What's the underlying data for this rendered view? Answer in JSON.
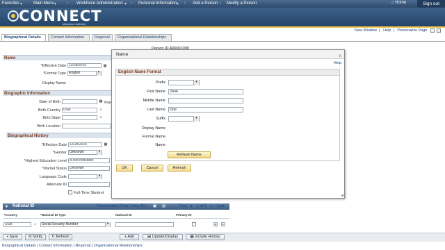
{
  "nav": {
    "items": [
      "Favorites",
      "Main Menu",
      "Workforce Administration",
      "Personal Information",
      "Add a Person",
      "Modify a Person"
    ],
    "home": "Home",
    "signout": "Sign out"
  },
  "banner": {
    "title": "CONNECT",
    "subtitle": "Maryland Judiciary"
  },
  "toplinks": {
    "new_window": "New Window",
    "help": "Help",
    "personalize": "Personalize Page"
  },
  "tabs": [
    "Biographical Details",
    "Contact Information",
    "Regional",
    "Organizational Relationships"
  ],
  "person": {
    "id_label": "Person ID",
    "id_value": "A00001000"
  },
  "name_section": {
    "header": "Name",
    "effective_date_label": "*Effective Date",
    "effective_date": "12/28/2015",
    "format_type_label": "*Format Type",
    "format_type": "English",
    "display_name_label": "Display Name"
  },
  "bio_section": {
    "header": "Biographic Information",
    "dob_label": "Date of Birth",
    "years_label": "Year",
    "birth_country_label": "Birth Country",
    "birth_country": "USA",
    "birth_state_label": "Birth State",
    "birth_location_label": "Birth Location"
  },
  "history_section": {
    "header": "Biographical History",
    "effective_date_label": "*Effective Date",
    "effective_date": "12/28/2015",
    "gender_label": "*Gender",
    "gender": "Unknown",
    "education_label": "*Highest Education Level",
    "education": "A-Not Indicated",
    "marital_label": "*Marital Status",
    "marital": "Unknown",
    "language_label": "Language Code",
    "alternate_id_label": "Alternate ID",
    "fulltime_label": "Full-Time Student"
  },
  "national_id": {
    "header": "National ID",
    "nav_links": "Personalize | Find | View All |",
    "pager": "First",
    "pager_count": "1 of 1",
    "pager_last": "Last",
    "columns": [
      "*Country",
      "*National ID Type",
      "National ID",
      "Primary ID"
    ],
    "row": {
      "country": "USA",
      "id_type": "Social Security Number",
      "national_id": ""
    }
  },
  "buttons": {
    "save": "Save",
    "notify": "Notify",
    "refresh": "Refresh",
    "add": "Add",
    "update_display": "Update/Display",
    "include_history": "Include History"
  },
  "bottomlinks": "Biographical Details | Contact Information | Regional | Organizational Relationships",
  "modal": {
    "title": "Name",
    "close": "x",
    "help": "Help",
    "group_title": "English Name Format",
    "fields": {
      "prefix_label": "Prefix",
      "first_label": "First Name",
      "first_value": "Jane",
      "middle_label": "Middle Name",
      "middle_value": "",
      "last_label": "Last Name",
      "last_value": "Doe",
      "suffix_label": "Suffix",
      "display_label": "Display Name",
      "formal_label": "Formal Name",
      "name_label": "Name"
    },
    "refresh_name": "Refresh Name",
    "ok": "OK",
    "cancel": "Cancel",
    "refresh": "Refresh"
  },
  "colors": {
    "nav_bg": "#2e4b6d",
    "accent_gold": "#f0c64a",
    "section_text": "#7b3a1c",
    "link": "#21457c"
  }
}
